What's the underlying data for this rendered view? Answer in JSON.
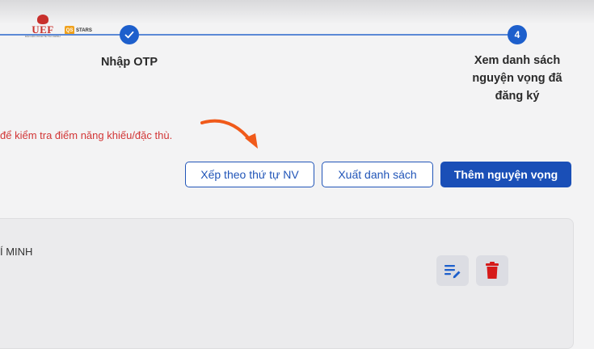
{
  "logos": {
    "uef_text": "UEF",
    "uef_subtitle": "ĐẠI HỌC KINH TẾ TÀI CHÍNH",
    "stars_badge": "QS",
    "stars_text": "STARS"
  },
  "stepper": {
    "step3_label": "Nhập OTP",
    "step4_number": "4",
    "step4_label_line1": "Xem danh sách",
    "step4_label_line2": "nguyện vọng đã",
    "step4_label_line3": "đăng ký"
  },
  "notice": "để kiểm tra điểm năng khiếu/đặc thù.",
  "actions": {
    "sort_label": "Xếp theo thứ tự NV",
    "export_label": "Xuất danh sách",
    "add_label": "Thêm nguyện vọng"
  },
  "card": {
    "text": "Í MINH"
  },
  "colors": {
    "primary": "#1a4fb7",
    "step_blue": "#1d5fcc",
    "notice_red": "#d23636",
    "arrow_orange": "#f05a1a",
    "delete_red": "#d61a1a"
  },
  "icons": {
    "check": "check-icon",
    "arrow": "arrow-icon",
    "edit": "edit-list-icon",
    "delete": "trash-icon"
  }
}
